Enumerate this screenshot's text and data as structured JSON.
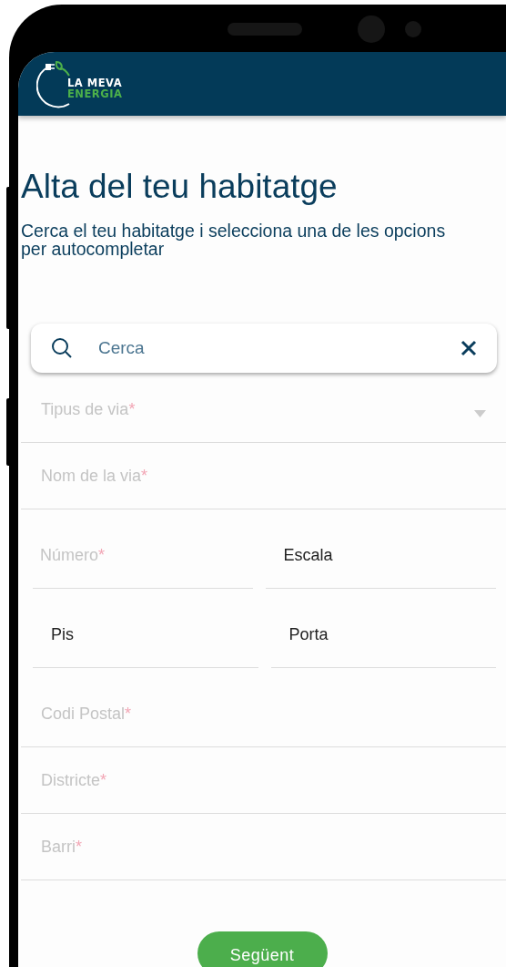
{
  "header": {
    "logo_lines": [
      "LA MEVA",
      "ENERGIA"
    ]
  },
  "title": "Alta del teu habitatge",
  "subtitle": "Cerca el teu habitatge i selecciona una de les opcions per autocompletar",
  "search": {
    "placeholder": "Cerca"
  },
  "fields": [
    {
      "kind": "select",
      "placeholder": "Tipus de via",
      "required_mark": "*"
    },
    {
      "kind": "text",
      "placeholder": "Nom de la via",
      "required_mark": "*"
    },
    {
      "kind": "pair",
      "items": [
        {
          "placeholder": "Número",
          "required_mark": "*"
        },
        {
          "value": "Escala"
        }
      ]
    },
    {
      "kind": "pair",
      "items": [
        {
          "value": "Pis"
        },
        {
          "value": "Porta"
        }
      ]
    },
    {
      "kind": "text",
      "placeholder": "Codi Postal",
      "required_mark": "*"
    },
    {
      "kind": "text",
      "placeholder": "Districte",
      "required_mark": "*"
    },
    {
      "kind": "text",
      "placeholder": "Barri",
      "required_mark": "*"
    }
  ],
  "next_button": "Següent"
}
